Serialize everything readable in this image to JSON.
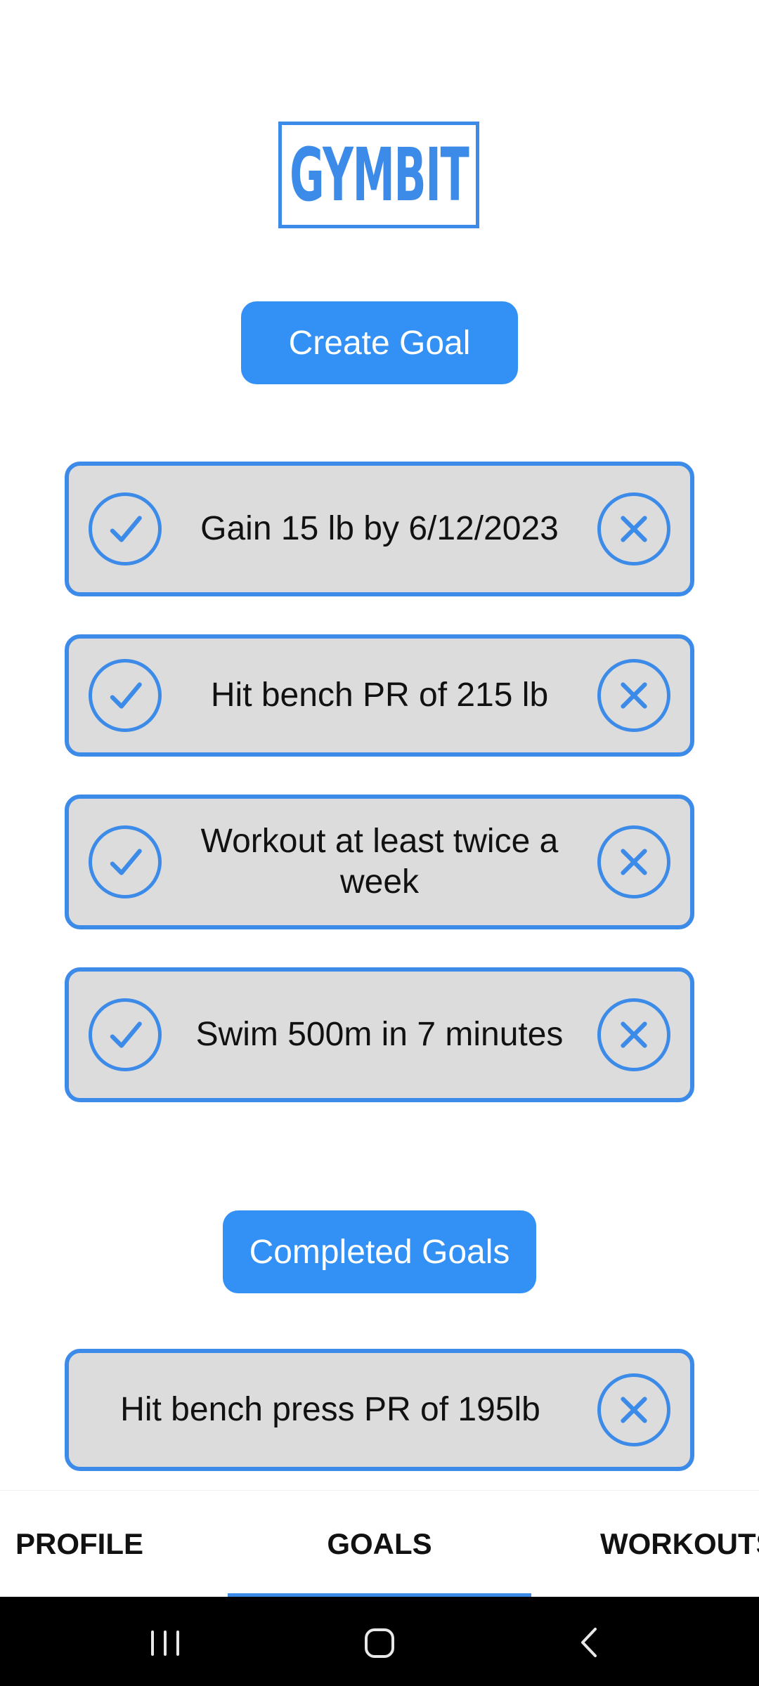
{
  "app": {
    "logo_text": "GYMBIT"
  },
  "buttons": {
    "create_goal": "Create Goal",
    "completed_goals": "Completed Goals"
  },
  "goals": [
    {
      "text": "Gain 15 lb by 6/12/2023"
    },
    {
      "text": "Hit bench PR of 215 lb"
    },
    {
      "text": "Workout at least twice a week"
    },
    {
      "text": "Swim 500m in 7 minutes"
    }
  ],
  "completed_goals": [
    {
      "text": "Hit bench press PR of 195lb"
    }
  ],
  "tabs": {
    "profile": "PROFILE",
    "goals": "GOALS",
    "workouts": "WORKOUTS",
    "active": "GOALS"
  },
  "icons": {
    "complete": "check-icon",
    "delete": "close-icon",
    "nav_recents": "recents-icon",
    "nav_home": "home-icon",
    "nav_back": "back-icon"
  },
  "colors": {
    "accent": "#3390f4",
    "border": "#3d8be8",
    "card_bg": "#dcdcdc",
    "nav_bar": "#000000"
  }
}
